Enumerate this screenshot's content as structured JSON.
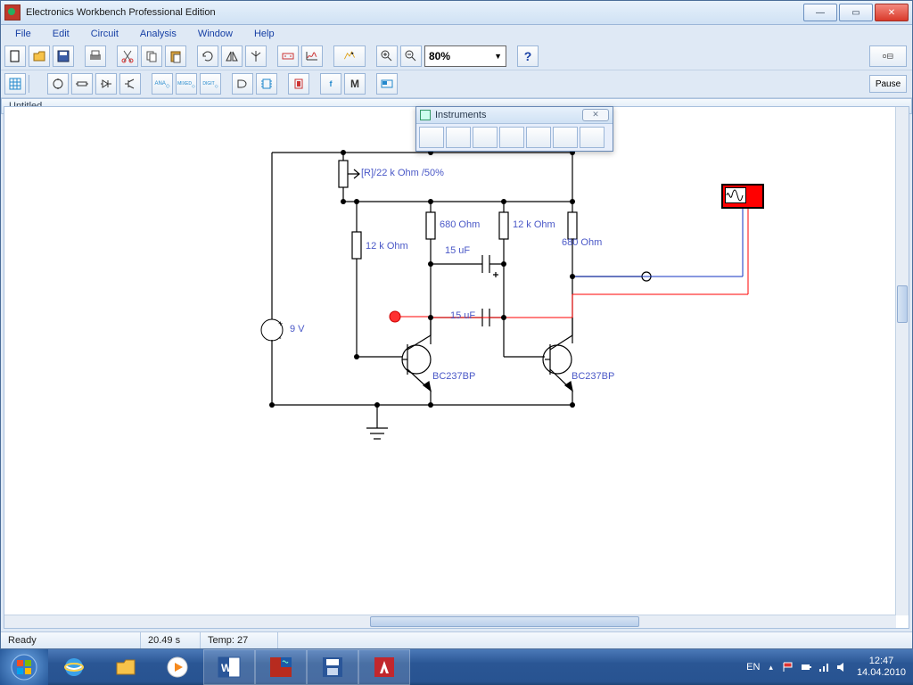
{
  "window": {
    "title": "Electronics Workbench Professional Edition"
  },
  "menu": {
    "file": "File",
    "edit": "Edit",
    "circuit": "Circuit",
    "analysis": "Analysis",
    "window": "Window",
    "help": "Help"
  },
  "toolbar": {
    "zoom": "80%",
    "help_icon": "?",
    "pause": "Pause",
    "m": "M",
    "ana": "ANA",
    "mixed": "MIXED",
    "digit": "DIGIT"
  },
  "doc": {
    "tab_title": "Untitled"
  },
  "panel": {
    "title": "Instruments",
    "close": "✕"
  },
  "circuit": {
    "v_source": "9 V",
    "pot": "[R]/22 k Ohm /50%",
    "r_left": "12 k Ohm",
    "r_mid": "680  Ohm",
    "r_right1": "12 k Ohm",
    "r_right2": "680  Ohm",
    "c1": "15 uF",
    "c2": "15 uF",
    "q1": "BC237BP",
    "q2": "BC237BP"
  },
  "status": {
    "ready": "Ready",
    "time": "20.49 s",
    "temp": "Temp:  27"
  },
  "tray": {
    "lang": "EN",
    "time": "12:47",
    "date": "14.04.2010"
  }
}
